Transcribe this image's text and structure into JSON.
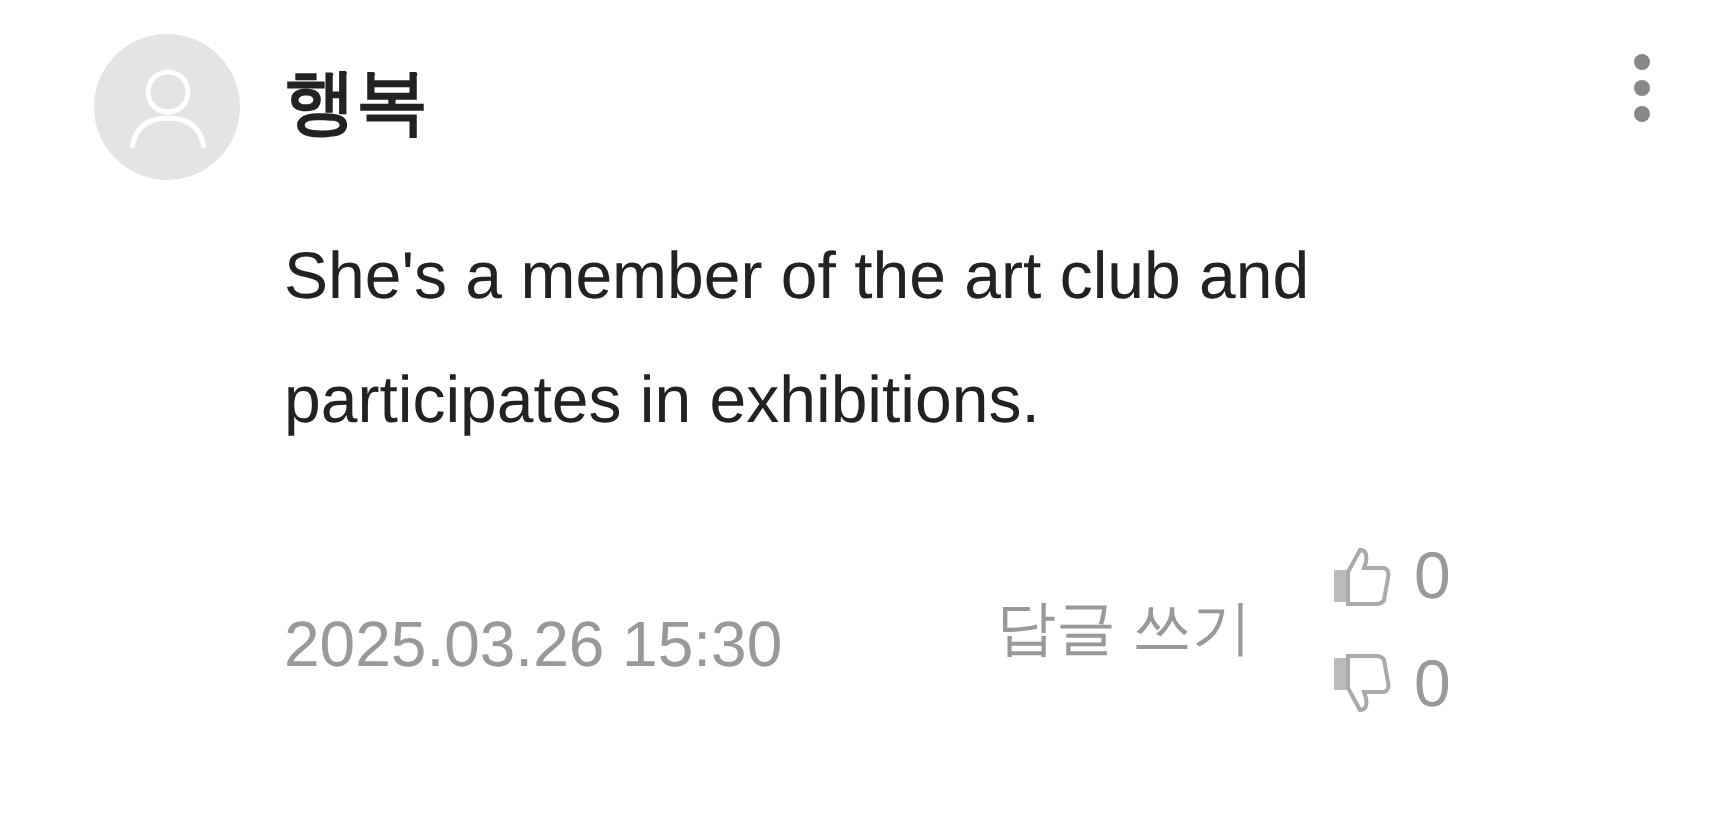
{
  "comment": {
    "author": "행복",
    "text": "She's a member of the art club and participates in exhibitions.",
    "date": "2025.03.26 15:30",
    "reply_label": "답글 쓰기",
    "likes": "0",
    "dislikes": "0"
  }
}
